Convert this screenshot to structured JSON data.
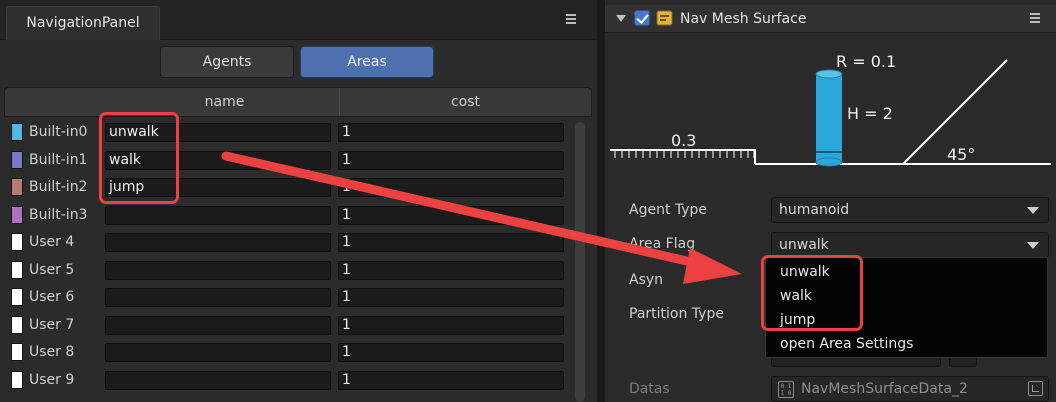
{
  "left_panel": {
    "tab_title": "NavigationPanel",
    "segments": {
      "agents": "Agents",
      "areas": "Areas"
    },
    "columns": {
      "name": "name",
      "cost": "cost"
    },
    "rows": [
      {
        "label": "Built-in0",
        "name": "unwalk",
        "cost": "1",
        "color": "#4fb8e6"
      },
      {
        "label": "Built-in1",
        "name": "walk",
        "cost": "1",
        "color": "#7878c8"
      },
      {
        "label": "Built-in2",
        "name": "jump",
        "cost": "1",
        "color": "#b87878"
      },
      {
        "label": "Built-in3",
        "name": "",
        "cost": "1",
        "color": "#b070c0"
      },
      {
        "label": "User 4",
        "name": "",
        "cost": "1",
        "color": "#ffffff"
      },
      {
        "label": "User 5",
        "name": "",
        "cost": "1",
        "color": "#ffffff"
      },
      {
        "label": "User 6",
        "name": "",
        "cost": "1",
        "color": "#ffffff"
      },
      {
        "label": "User 7",
        "name": "",
        "cost": "1",
        "color": "#ffffff"
      },
      {
        "label": "User 8",
        "name": "",
        "cost": "1",
        "color": "#ffffff"
      },
      {
        "label": "User 9",
        "name": "",
        "cost": "1",
        "color": "#ffffff"
      }
    ]
  },
  "right_panel": {
    "component_title": "Nav Mesh Surface",
    "diagram": {
      "radius": "R = 0.1",
      "height": "H = 2",
      "step": "0.3",
      "slope": "45°"
    },
    "agent_type": {
      "label": "Agent Type",
      "value": "humanoid"
    },
    "area_flag": {
      "label": "Area Flag",
      "value": "unwalk"
    },
    "asyn_label": "Asyn",
    "partition_label": "Partition Type",
    "dropdown_options": [
      "unwalk",
      "walk",
      "jump",
      "open Area Settings"
    ],
    "datas": {
      "label": "Datas",
      "value": "NavMeshSurfaceData_2"
    }
  },
  "colors": {
    "accent": "#4e6fb0",
    "annotation": "#ec4141",
    "capsule": "#2aa7db"
  }
}
